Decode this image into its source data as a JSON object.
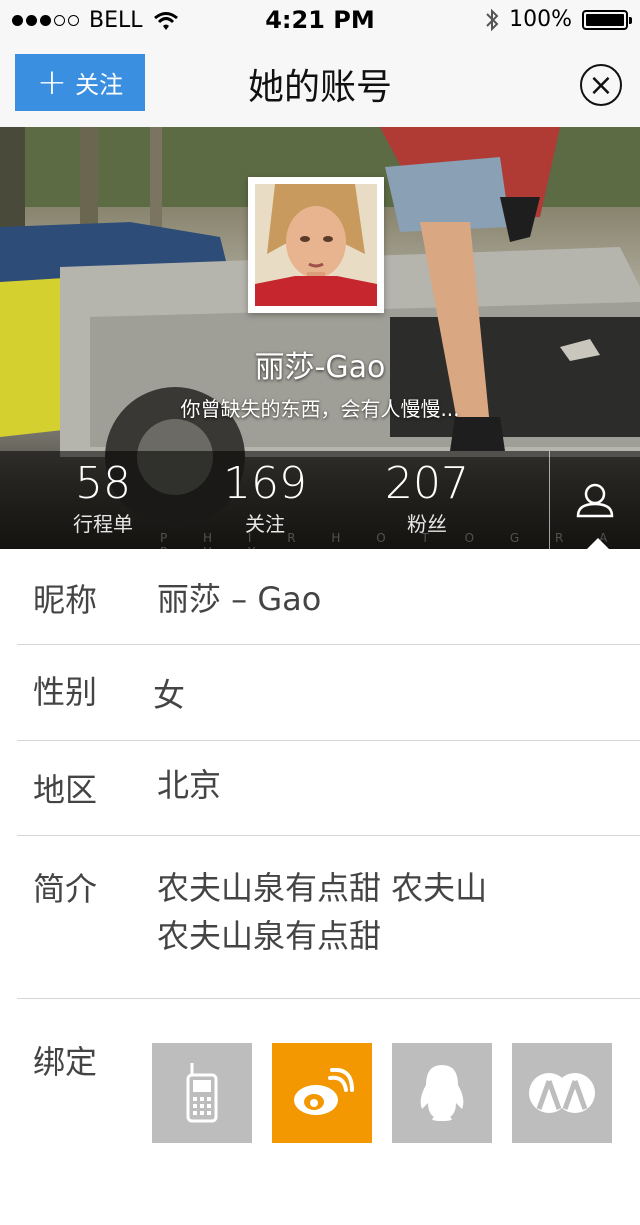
{
  "status_bar": {
    "carrier": "BELL",
    "time": "4:21 PM",
    "battery": "100%",
    "battery_level": 1.0,
    "signal_bars_filled": 3,
    "signal_bars_total": 5
  },
  "nav": {
    "follow_label": "关注",
    "title": "她的账号"
  },
  "profile": {
    "name": "丽莎-Gao",
    "bio": "你曾缺失的东西，会有人慢慢..."
  },
  "stats": [
    {
      "num": "58",
      "label": "行程单"
    },
    {
      "num": "169",
      "label": "关注"
    },
    {
      "num": "207",
      "label": "粉丝"
    }
  ],
  "watermark": "P H I R H O T O G R A P H Y",
  "info": {
    "nickname_label": "昵称",
    "nickname_value": "丽莎 – Gao",
    "gender_label": "性别",
    "gender_value": "女",
    "region_label": "地区",
    "region_value": "北京",
    "intro_label": "简介",
    "intro_line1": "农夫山泉有点甜 农夫山",
    "intro_line2": "农夫山泉有点甜",
    "bind_label": "绑定"
  },
  "bind_accounts": [
    {
      "icon": "phone-icon",
      "bound": false,
      "color": "#bdbdbd"
    },
    {
      "icon": "weibo-icon",
      "bound": true,
      "color": "#f39800"
    },
    {
      "icon": "qq-icon",
      "bound": false,
      "color": "#bdbdbd"
    },
    {
      "icon": "renren-icon",
      "bound": false,
      "color": "#bdbdbd"
    }
  ],
  "colors": {
    "accent": "#3b8fe0",
    "weibo": "#f39800",
    "inactive": "#bdbdbd"
  }
}
